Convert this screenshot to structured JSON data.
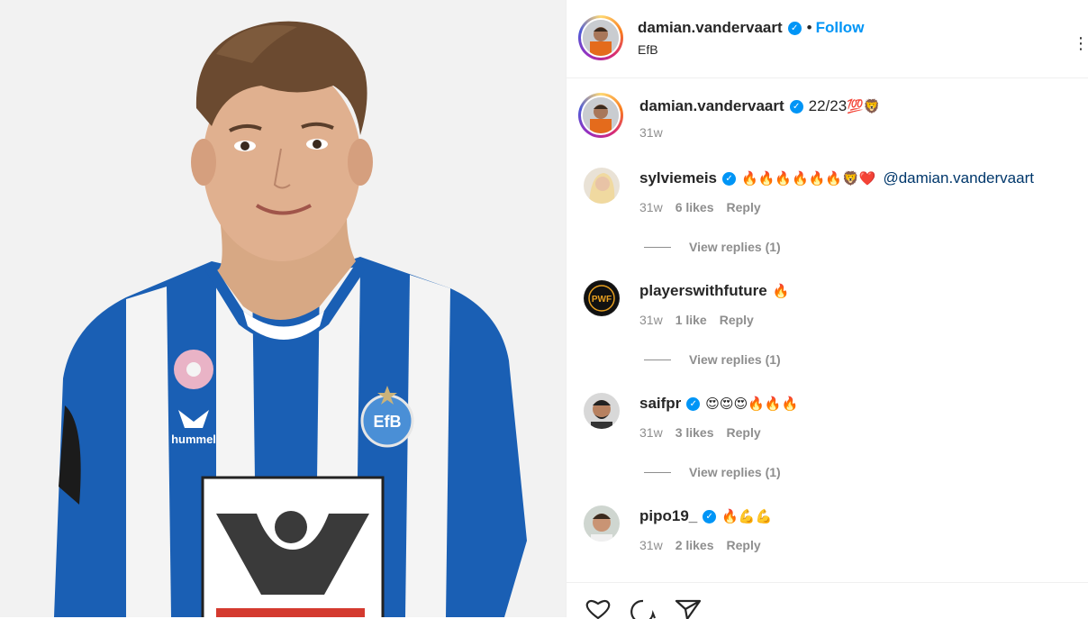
{
  "post": {
    "author": "damian.vandervaart",
    "follow_label": "Follow",
    "dot": "•",
    "location": "EfB",
    "caption_author": "damian.vandervaart",
    "caption_text": "22/23",
    "caption_emoji": "💯🦁",
    "caption_time": "31w"
  },
  "comments": [
    {
      "user": "sylviemeis",
      "verified": true,
      "emoji": "🔥🔥🔥🔥🔥🔥🦁❤️",
      "mention": "@damian.vandervaart",
      "time": "31w",
      "likes": "6 likes",
      "reply": "Reply",
      "view_replies": "View replies (1)"
    },
    {
      "user": "playerswithfuture",
      "verified": false,
      "emoji": "🔥",
      "avatar_text": "PWF",
      "time": "31w",
      "likes": "1 like",
      "reply": "Reply",
      "view_replies": "View replies (1)"
    },
    {
      "user": "saifpr",
      "verified": true,
      "emoji": "😍😍😍🔥🔥🔥",
      "time": "31w",
      "likes": "3 likes",
      "reply": "Reply",
      "view_replies": "View replies (1)"
    },
    {
      "user": "pipo19_",
      "verified": true,
      "emoji": "🔥💪💪",
      "time": "31w",
      "likes": "2 likes",
      "reply": "Reply"
    }
  ],
  "photo": {
    "sponsor_text": "hummel",
    "crest_text": "EfB"
  },
  "colors": {
    "accent": "#0095f6",
    "jersey_blue": "#1a5fb4",
    "text": "#262626",
    "muted": "#8e8e8e"
  },
  "icons": [
    "heart-icon",
    "comment-icon",
    "share-icon",
    "more-icon",
    "verified-icon"
  ]
}
